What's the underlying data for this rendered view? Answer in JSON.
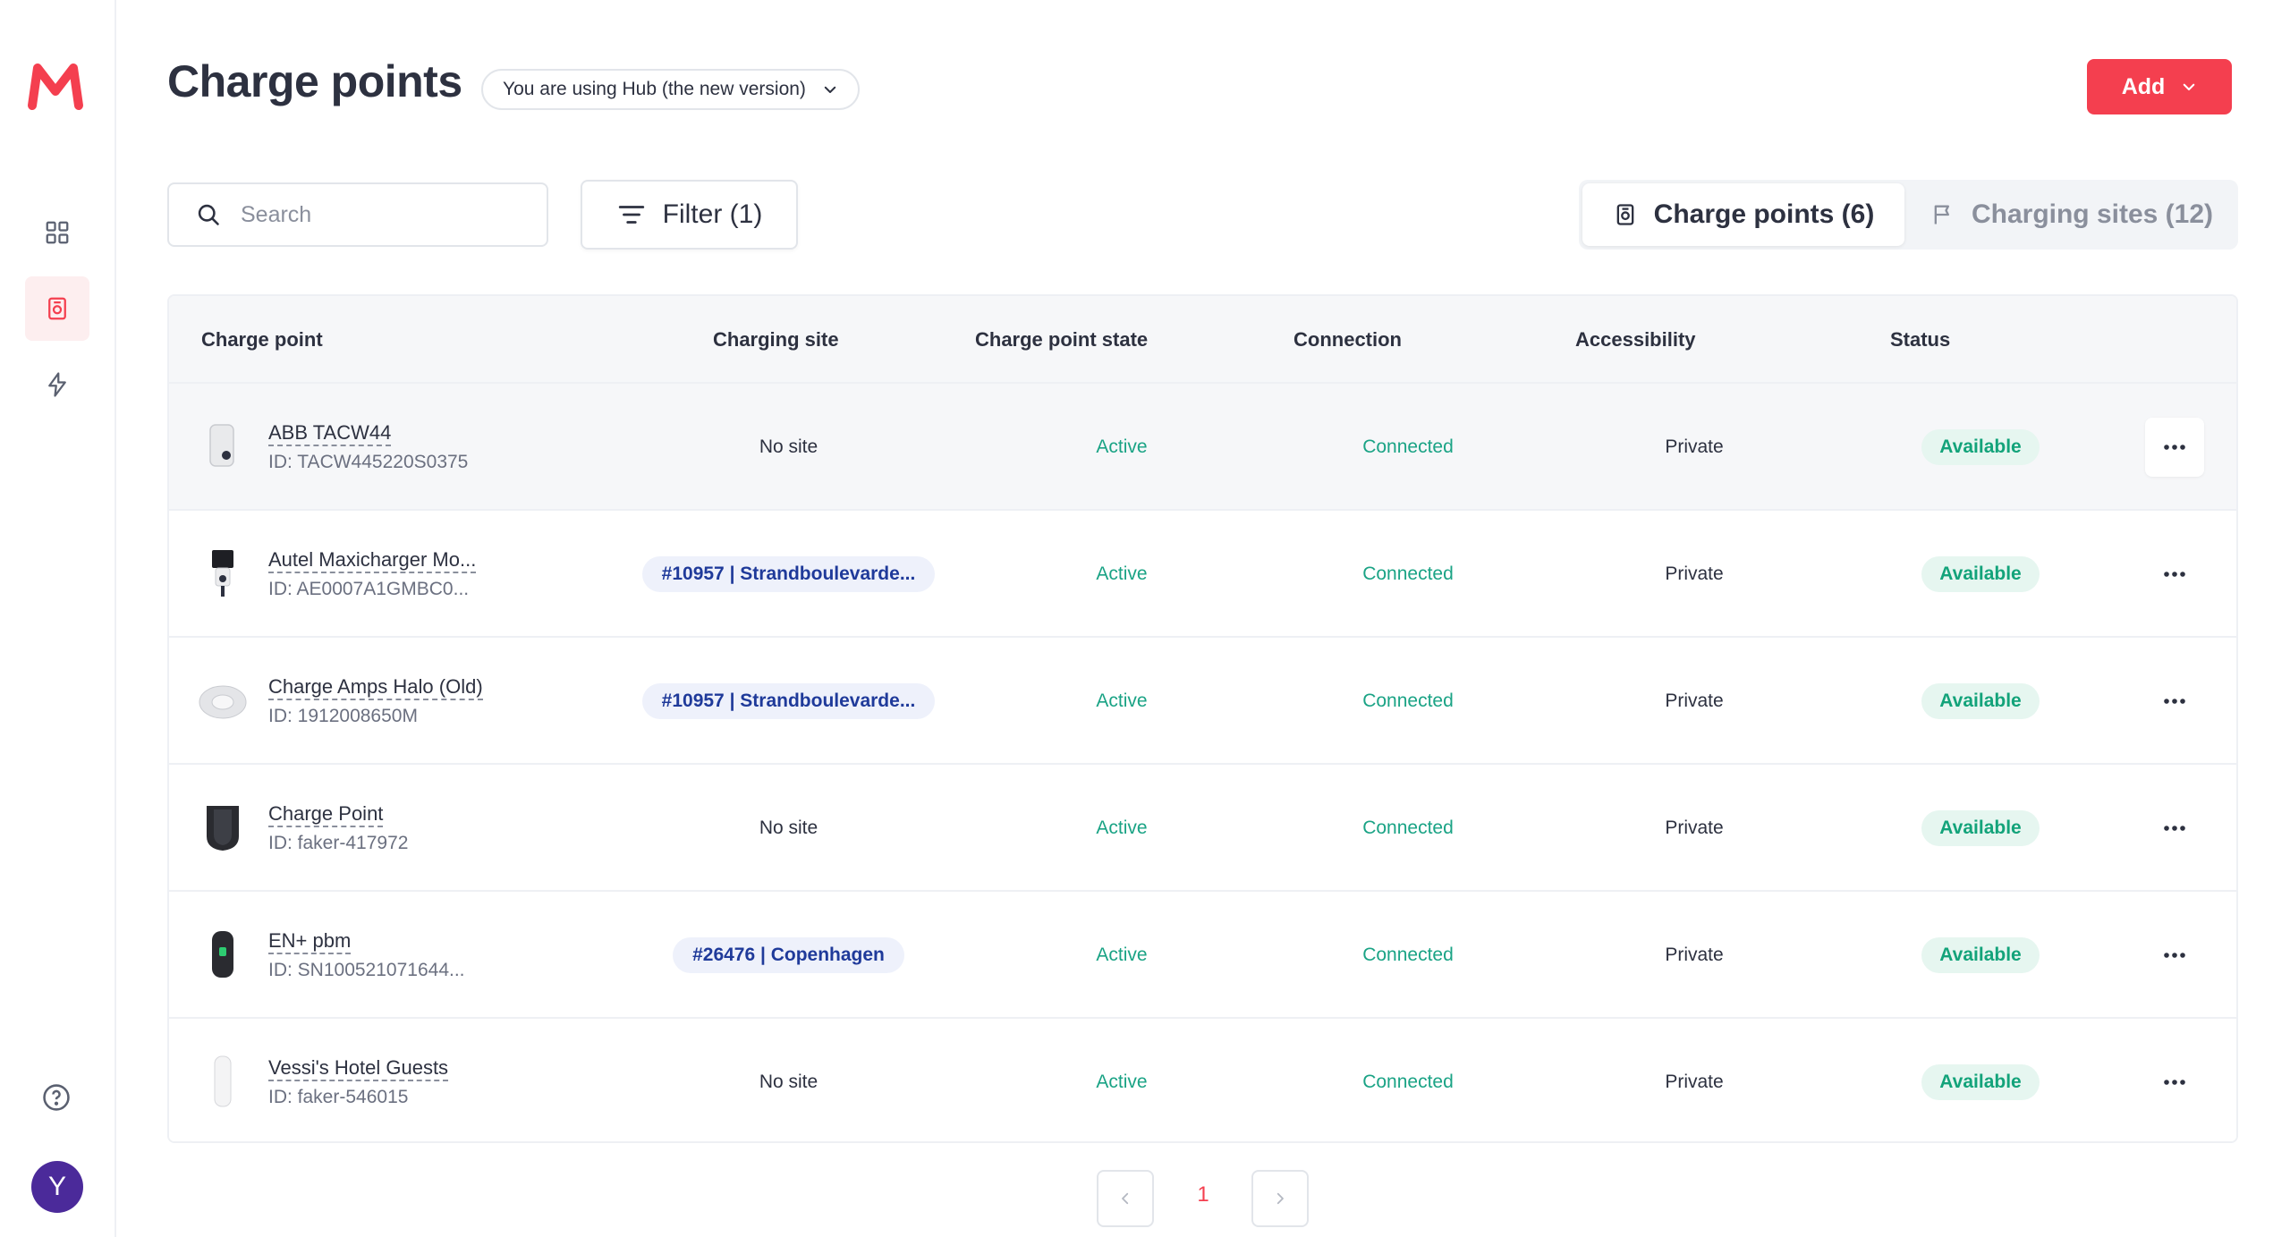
{
  "app": {
    "logo": "M",
    "avatar_initial": "Y"
  },
  "colors": {
    "accent": "#f43f4f",
    "success": "#1aa385",
    "site_chip": "#1f3a9a"
  },
  "sidebar": {
    "items": [
      {
        "icon": "grid-icon",
        "active": false
      },
      {
        "icon": "charge-point-icon",
        "active": true
      },
      {
        "icon": "lightning-icon",
        "active": false
      }
    ],
    "help_icon": "help-circle-icon"
  },
  "header": {
    "title": "Charge points",
    "version_label": "You are using Hub (the new version)",
    "add_label": "Add"
  },
  "toolbar": {
    "search_placeholder": "Search",
    "filter_label": "Filter (1)",
    "tab_charge_points": "Charge points (6)",
    "tab_charging_sites": "Charging sites (12)"
  },
  "table": {
    "columns": [
      "Charge point",
      "Charging site",
      "Charge point state",
      "Connection",
      "Accessibility",
      "Status"
    ],
    "rows": [
      {
        "name": "ABB TACW44",
        "id": "ID: TACW445220S0375",
        "site": "No site",
        "site_linked": false,
        "state": "Active",
        "connection": "Connected",
        "accessibility": "Private",
        "status": "Available"
      },
      {
        "name": "Autel Maxicharger Mo...",
        "id": "ID: AE0007A1GMBC0...",
        "site": "#10957 | Strandboulevarde...",
        "site_linked": true,
        "state": "Active",
        "connection": "Connected",
        "accessibility": "Private",
        "status": "Available"
      },
      {
        "name": "Charge Amps Halo (Old)",
        "id": "ID: 1912008650M",
        "site": "#10957 | Strandboulevarde...",
        "site_linked": true,
        "state": "Active",
        "connection": "Connected",
        "accessibility": "Private",
        "status": "Available"
      },
      {
        "name": "Charge Point",
        "id": "ID: faker-417972",
        "site": "No site",
        "site_linked": false,
        "state": "Active",
        "connection": "Connected",
        "accessibility": "Private",
        "status": "Available"
      },
      {
        "name": "EN+ pbm",
        "id": "ID: SN100521071644...",
        "site": "#26476 | Copenhagen",
        "site_linked": true,
        "state": "Active",
        "connection": "Connected",
        "accessibility": "Private",
        "status": "Available"
      },
      {
        "name": "Vessi's Hotel Guests",
        "id": "ID: faker-546015",
        "site": "No site",
        "site_linked": false,
        "state": "Active",
        "connection": "Connected",
        "accessibility": "Private",
        "status": "Available"
      }
    ]
  },
  "pagination": {
    "current_page": "1"
  }
}
